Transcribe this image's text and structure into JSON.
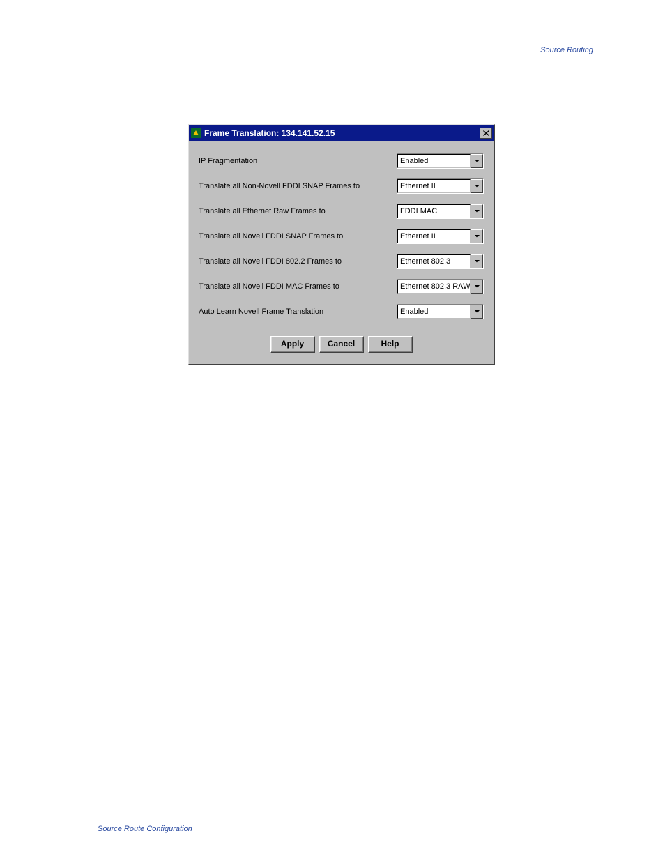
{
  "page": {
    "header_text": "Source Routing",
    "footer_text": "Source Route Configuration"
  },
  "dialog": {
    "title": "Frame Translation: 134.141.52.15",
    "fields": [
      {
        "label": "IP Fragmentation",
        "value": "Enabled"
      },
      {
        "label": "Translate all Non-Novell FDDI SNAP Frames to",
        "value": "Ethernet II"
      },
      {
        "label": "Translate all Ethernet Raw Frames to",
        "value": "FDDI MAC"
      },
      {
        "label": "Translate all Novell FDDI SNAP Frames to",
        "value": "Ethernet II"
      },
      {
        "label": "Translate all Novell FDDI 802.2 Frames to",
        "value": "Ethernet 802.3"
      },
      {
        "label": "Translate all Novell FDDI MAC Frames to",
        "value": "Ethernet 802.3 RAW"
      },
      {
        "label": "Auto Learn Novell Frame Translation",
        "value": "Enabled"
      }
    ],
    "buttons": {
      "apply": "Apply",
      "cancel": "Cancel",
      "help": "Help"
    }
  }
}
